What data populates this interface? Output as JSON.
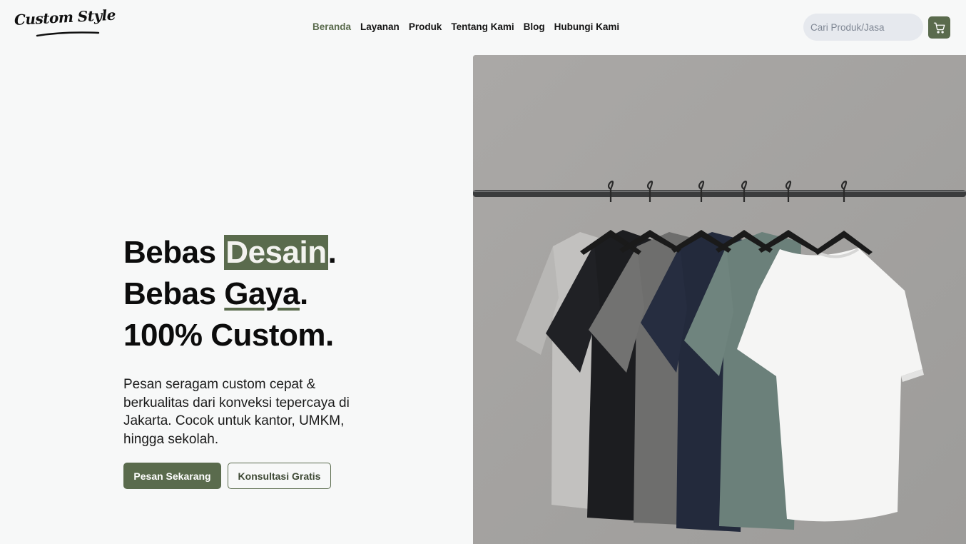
{
  "brand": {
    "logo_text": "Custom Style"
  },
  "nav": {
    "items": [
      {
        "label": "Beranda",
        "active": true
      },
      {
        "label": "Layanan",
        "active": false
      },
      {
        "label": "Produk",
        "active": false
      },
      {
        "label": "Tentang Kami",
        "active": false
      },
      {
        "label": "Blog",
        "active": false
      },
      {
        "label": "Hubungi Kami",
        "active": false
      }
    ]
  },
  "search": {
    "placeholder": "Cari Produk/Jasa",
    "value": ""
  },
  "cart": {
    "icon": "cart-icon"
  },
  "hero": {
    "line1_pre": "Bebas ",
    "line1_highlight": "Desain",
    "line1_post": ".",
    "line2_pre": "Bebas ",
    "line2_highlight": "Gaya",
    "line2_post": ".",
    "line3": "100% Custom.",
    "description": "Pesan seragam custom cepat & berkualitas dari konveksi tepercaya di Jakarta. Cocok untuk kantor, UMKM, hingga sekolah.",
    "primary_button": "Pesan Sekarang",
    "secondary_button": "Konsultasi Gratis"
  },
  "colors": {
    "accent": "#5a6b4d",
    "background": "#f7f8f8",
    "search_bg": "#e6e9ee",
    "text": "#111111"
  }
}
